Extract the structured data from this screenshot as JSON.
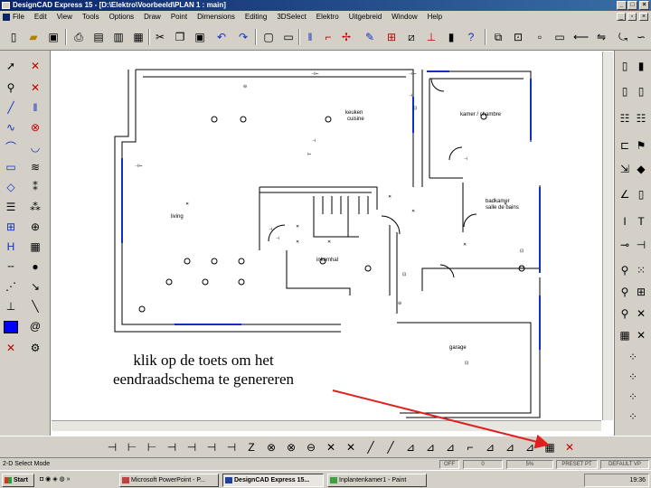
{
  "window": {
    "title": "DesignCAD Express 15 - [D:\\Elektro\\Voorbeeld\\PLAN 1 : main]",
    "minimize_icon": "minimize-icon",
    "maximize_icon": "maximize-icon",
    "close_icon": "close-icon"
  },
  "menu": {
    "items": [
      "File",
      "Edit",
      "View",
      "Tools",
      "Options",
      "Draw",
      "Point",
      "Dimensions",
      "Editing",
      "3DSelect",
      "Elektro",
      "Uitgebreid",
      "Window",
      "Help"
    ]
  },
  "drawing": {
    "rooms": {
      "keuken": "keuken",
      "cuisine": "cuisine",
      "kamer": "kamer / chambre",
      "living": "living",
      "badkamer": "badkamer",
      "salle_de_bains": "salle de bains",
      "inkomhal": "inkomhal",
      "garage": "garage"
    }
  },
  "annotation": {
    "line1": "klik op de toets om het",
    "line2": "eendraadschema te genereren"
  },
  "status": {
    "mode": "2-D Select Mode",
    "off": "OFF",
    "zero": "0",
    "percent": "5%",
    "preset": "PRESET PT",
    "default": "DEFAULT VP"
  },
  "taskbar": {
    "start": "Start",
    "tasks": [
      "Microsoft PowerPoint - P...",
      "DesignCAD Express 15...",
      "Inplantenkamer1 - Paint"
    ],
    "clock": "19:36"
  },
  "colors": {
    "title_gradient_start": "#0a246a",
    "chrome": "#d4d0c8",
    "wall_blue": "#1030c0",
    "arrow_red": "#e02020",
    "active_color_swatch": "#0000ff"
  }
}
